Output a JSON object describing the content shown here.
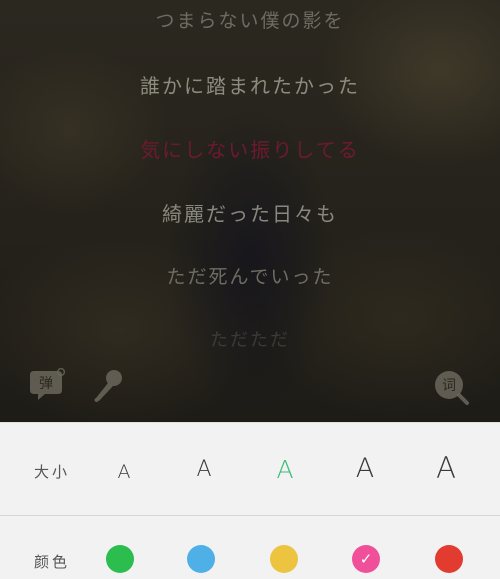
{
  "lyrics": {
    "lines": [
      "つまらない僕の影を",
      "誰かに踏まれたかった",
      "気にしない振りしてる",
      "綺麗だった日々も",
      "ただ死んでいった",
      "ただただ"
    ],
    "current_index": 2,
    "current_color": "#6e1a2e"
  },
  "toolbar": {
    "danmaku_icon": "danmaku-bubble-icon",
    "danmaku_label": "弹",
    "mic_icon": "microphone-icon",
    "lyric_icon": "lyric-search-icon",
    "lyric_label": "词"
  },
  "settings": {
    "size": {
      "label": "大小",
      "options": [
        "A",
        "A",
        "A",
        "A",
        "A"
      ],
      "selected_index": 2,
      "selected_color": "#3cbc7c"
    },
    "color": {
      "label": "颜色",
      "swatches": [
        "#2bbd4e",
        "#4fb0e8",
        "#ecc440",
        "#f0509a",
        "#e23b30"
      ],
      "selected_index": 3
    }
  }
}
